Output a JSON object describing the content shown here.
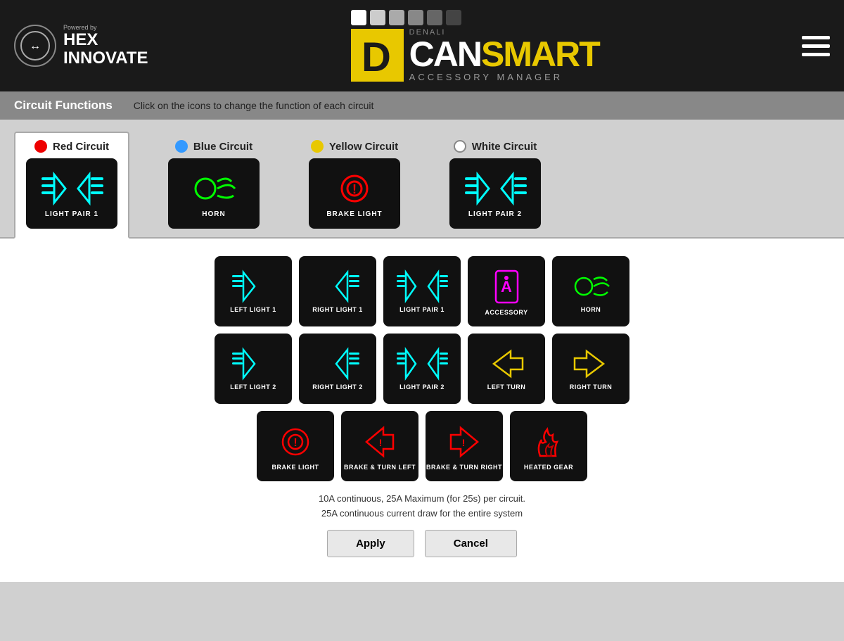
{
  "header": {
    "powered_by": "Powered by",
    "brand_name": "HEX\nINNOVATE",
    "center_brand": "DENALI",
    "can_text": "CAN",
    "smart_text": "SMART",
    "acc_manager": "ACCESSORY MANAGER",
    "squares": [
      "#ffffff",
      "#dddddd",
      "#bbbbbb",
      "#999999",
      "#777777",
      "#555555"
    ],
    "menu_label": "menu"
  },
  "circuit_bar": {
    "title": "Circuit Functions",
    "hint": "Click on the icons to change the function of each circuit"
  },
  "circuits": [
    {
      "id": "red",
      "name": "Red Circuit",
      "color": "red",
      "dot": "dot-red",
      "function": "LIGHT PAIR 1",
      "active": true
    },
    {
      "id": "blue",
      "name": "Blue Circuit",
      "color": "blue",
      "dot": "dot-blue",
      "function": "HORN",
      "active": false
    },
    {
      "id": "yellow",
      "name": "Yellow Circuit",
      "color": "yellow",
      "dot": "dot-yellow",
      "function": "BRAKE LIGHT",
      "active": false
    },
    {
      "id": "white",
      "name": "White Circuit",
      "color": "white",
      "dot": "dot-white",
      "function": "LIGHT PAIR 2",
      "active": false
    }
  ],
  "functions": {
    "rows": [
      [
        {
          "id": "left-light-1",
          "label": "LEFT LIGHT 1",
          "color": "cyan",
          "type": "left-beam"
        },
        {
          "id": "right-light-1",
          "label": "RIGHT LIGHT 1",
          "color": "cyan",
          "type": "right-beam"
        },
        {
          "id": "light-pair-1",
          "label": "LIGHT PAIR 1",
          "color": "cyan",
          "type": "pair-beam"
        },
        {
          "id": "accessory",
          "label": "ACCESSORY",
          "color": "magenta",
          "type": "accessory"
        },
        {
          "id": "horn",
          "label": "HORN",
          "color": "lime",
          "type": "horn"
        }
      ],
      [
        {
          "id": "left-light-2",
          "label": "LEFT LIGHT 2",
          "color": "cyan",
          "type": "left-beam"
        },
        {
          "id": "right-light-2",
          "label": "RIGHT LIGHT 2",
          "color": "cyan",
          "type": "right-beam"
        },
        {
          "id": "light-pair-2",
          "label": "LIGHT PAIR 2",
          "color": "cyan",
          "type": "pair-beam"
        },
        {
          "id": "left-turn",
          "label": "LEFT TURN",
          "color": "yellow",
          "type": "left-turn"
        },
        {
          "id": "right-turn",
          "label": "RIGHT TURN",
          "color": "yellow",
          "type": "right-turn"
        }
      ],
      [
        {
          "id": "brake-light",
          "label": "BRAKE LIGHT",
          "color": "red",
          "type": "brake"
        },
        {
          "id": "brake-turn-left",
          "label": "BRAKE & TURN LEFT",
          "color": "red",
          "type": "brake-turn-left"
        },
        {
          "id": "brake-turn-right",
          "label": "BRAKE & TURN RIGHT",
          "color": "red",
          "type": "brake-turn-right"
        },
        {
          "id": "heated-gear",
          "label": "HEATED GEAR",
          "color": "red",
          "type": "heated"
        }
      ]
    ],
    "notice": "10A continuous, 25A Maximum (for 25s) per circuit.\n25A continuous current draw for the entire system",
    "apply_label": "Apply",
    "cancel_label": "Cancel"
  }
}
